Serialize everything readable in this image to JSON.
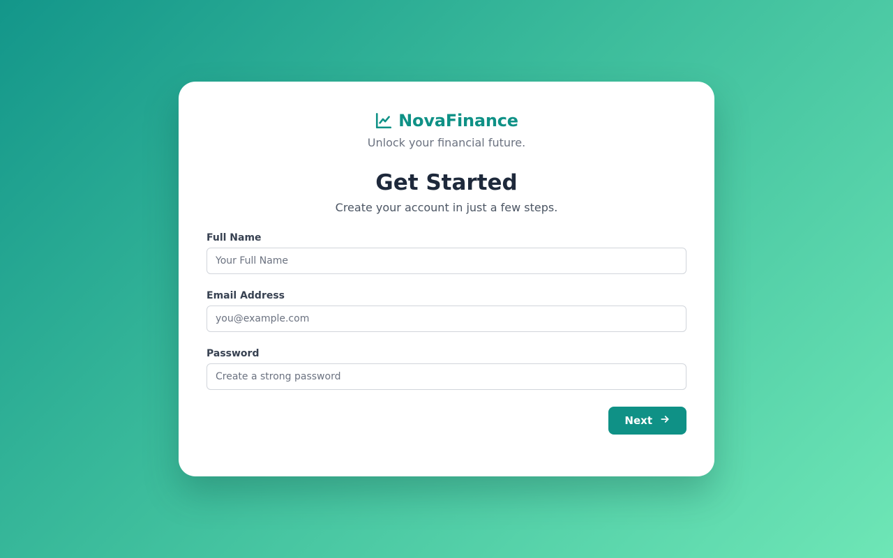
{
  "brand": {
    "name": "NovaFinance",
    "tagline": "Unlock your financial future.",
    "icon": "chart-line-icon",
    "color": "#0f9186"
  },
  "header": {
    "title": "Get Started",
    "subtitle": "Create your account in just a few steps."
  },
  "form": {
    "full_name": {
      "label": "Full Name",
      "placeholder": "Your Full Name",
      "value": ""
    },
    "email": {
      "label": "Email Address",
      "placeholder": "you@example.com",
      "value": ""
    },
    "password": {
      "label": "Password",
      "placeholder": "Create a strong password",
      "value": ""
    }
  },
  "actions": {
    "next_label": "Next",
    "next_icon": "arrow-right-icon"
  },
  "colors": {
    "accent": "#0f9186",
    "background_start": "#13968a",
    "background_end": "#6ee6b6"
  }
}
